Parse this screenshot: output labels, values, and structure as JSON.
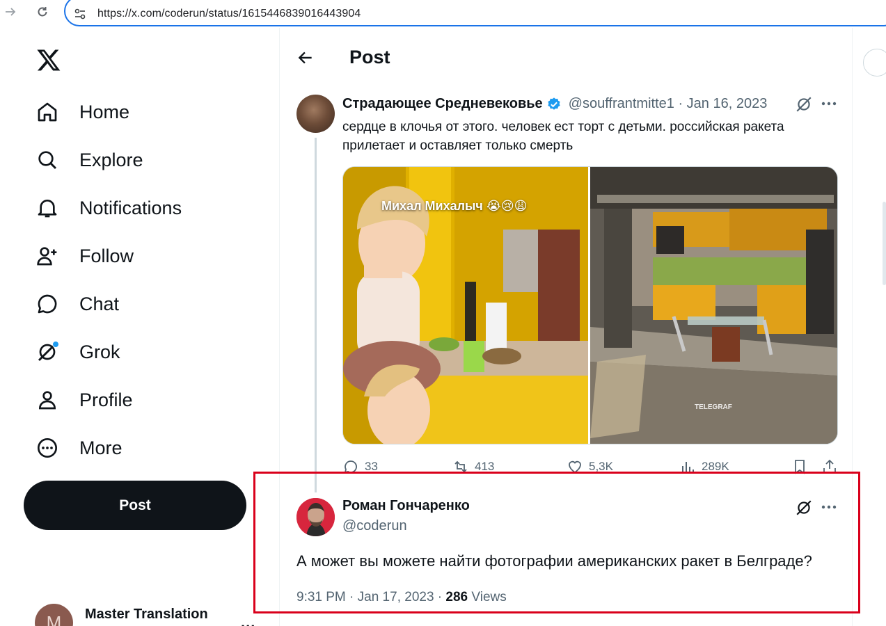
{
  "browser": {
    "url": "https://x.com/coderun/status/1615446839016443904"
  },
  "sidebar": {
    "items": [
      {
        "label": "Home",
        "icon": "home-icon"
      },
      {
        "label": "Explore",
        "icon": "search-icon"
      },
      {
        "label": "Notifications",
        "icon": "bell-icon"
      },
      {
        "label": "Follow",
        "icon": "person-add-icon"
      },
      {
        "label": "Chat",
        "icon": "chat-icon"
      },
      {
        "label": "Grok",
        "icon": "grok-icon"
      },
      {
        "label": "Profile",
        "icon": "person-icon"
      },
      {
        "label": "More",
        "icon": "more-circle-icon"
      }
    ],
    "post_label": "Post",
    "account": {
      "name": "Master Translation",
      "avatar_letter": "M",
      "menu": "..."
    }
  },
  "header": {
    "title": "Post"
  },
  "parent_tweet": {
    "author_name": "Страдающее Средневековье",
    "handle_and_date": "@souffrantmitte1 · Jan 16, 2023",
    "text": "сердце в клочья от этого. человек ест торт с детьми. российская ракета прилетает и оставляет только смерть",
    "media_caption": "Михал Михалыч 😭😢😩",
    "media_watermark": "TELEGRAF",
    "stats": {
      "replies": "33",
      "reposts": "413",
      "likes": "5,3K",
      "views": "289K"
    }
  },
  "main_tweet": {
    "author_name": "Роман Гончаренко",
    "handle": "@coderun",
    "text": "А может вы можете найти фотографии американских ракет в Белграде?",
    "time_date": "9:31 PM · Jan 17, 2023 · ",
    "views_count": "286",
    "views_label": " Views"
  },
  "colors": {
    "accent": "#1d9bf0",
    "highlight_box": "#d9001b",
    "post_button": "#0f1419"
  }
}
